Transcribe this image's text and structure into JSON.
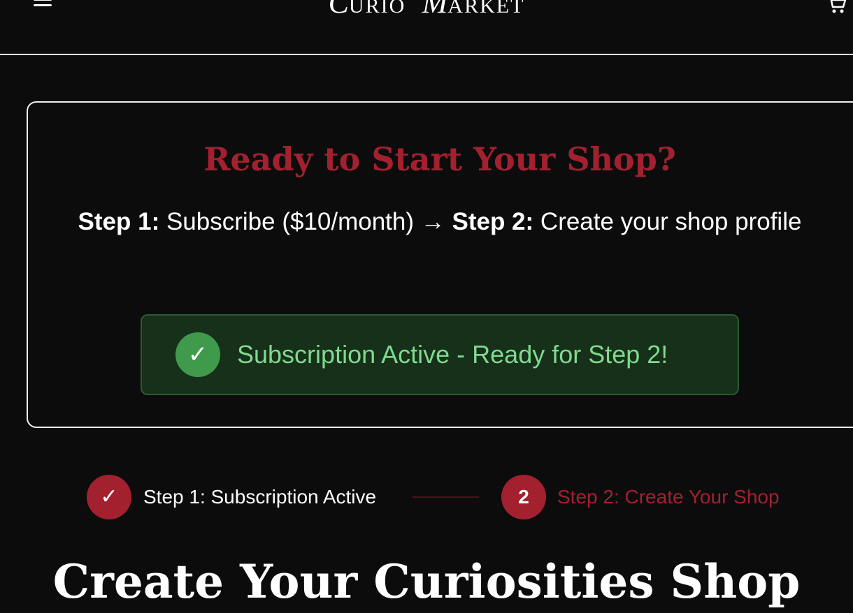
{
  "header": {
    "logo_first_initial": "C",
    "logo_first_rest": "URIO",
    "logo_second_initial": "M",
    "logo_second_rest": "ARKET",
    "menu_icon": "hamburger-menu-icon",
    "cart_icon": "shopping-cart-icon"
  },
  "promo": {
    "title": "Ready to Start Your Shop?",
    "step1_label": "Step 1:",
    "step1_text": " Subscribe ($10/month) ",
    "arrow": "→",
    "step2_label": "Step 2:",
    "step2_text": " Create your shop profile",
    "status_check": "✓",
    "status_text": "Subscription Active - Ready for Step 2!"
  },
  "progress": {
    "step1_check": "✓",
    "step1_label": "Step 1: Subscription Active",
    "step2_number": "2",
    "step2_label": "Step 2: Create Your Shop"
  },
  "main": {
    "section_title": "Create Your Curiosities Shop"
  },
  "colors": {
    "accent": "#a3212f",
    "success": "#7fd98f",
    "success_bg": "#173019",
    "background": "#0c0c0d"
  }
}
